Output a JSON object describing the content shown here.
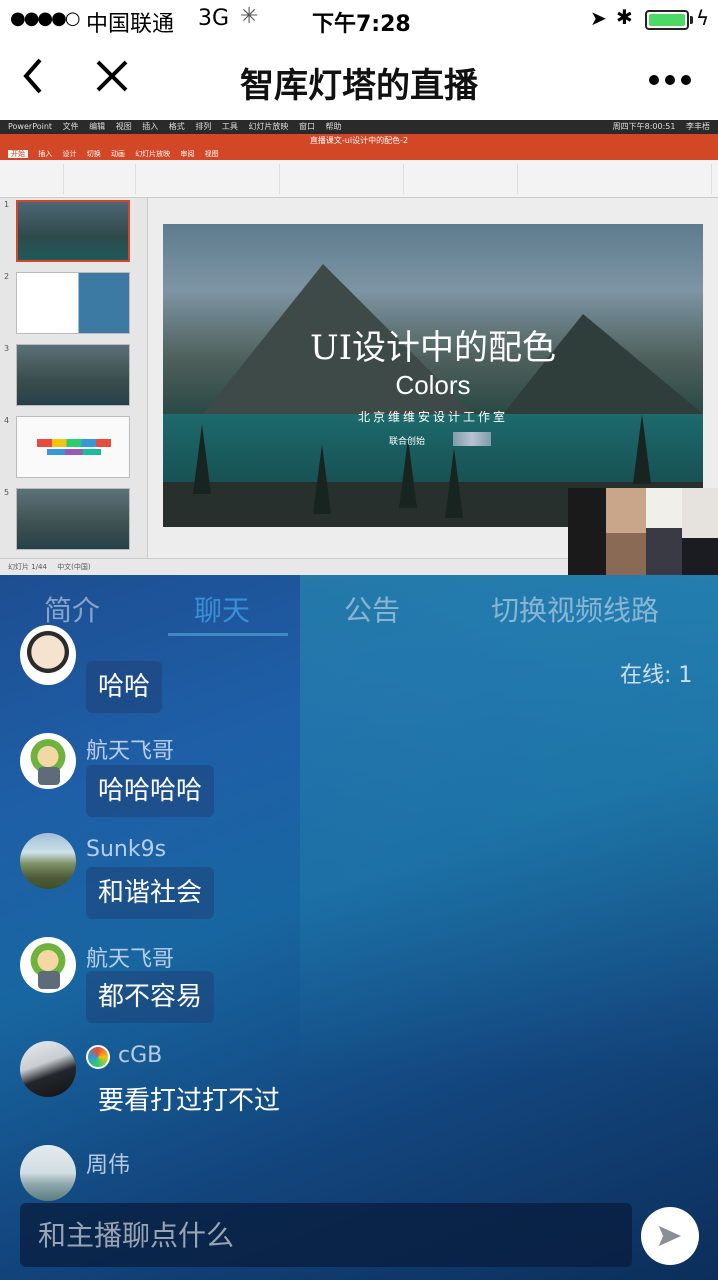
{
  "status_bar": {
    "signal": "●●●●○",
    "carrier": "中国联通",
    "network": "3G",
    "time": "下午7:28"
  },
  "nav": {
    "back_icon": "chevron-left-icon",
    "close_icon": "close-icon",
    "title": "智库灯塔的直播",
    "more_icon": "more-icon"
  },
  "video": {
    "app_menu": [
      "PowerPoint",
      "文件",
      "编辑",
      "视图",
      "插入",
      "格式",
      "排列",
      "工具",
      "幻灯片放映",
      "窗口",
      "帮助"
    ],
    "clock_text": "周四下午8:00:51",
    "user": "李丰梧",
    "doc_title": "直播课文-ui设计中的配色-2",
    "ribbon_tabs": [
      "开始",
      "插入",
      "设计",
      "切换",
      "动画",
      "幻灯片放映",
      "审阅",
      "视图"
    ],
    "thumb_numbers": [
      "1",
      "2",
      "3",
      "4",
      "5"
    ],
    "slide": {
      "title": "UI设计中的配色",
      "subtitle": "Colors",
      "org": "北京维维安设计工作室",
      "author": "联合创始"
    },
    "statusbar_slide": "幻灯片 1/44",
    "statusbar_lang": "中文(中国)"
  },
  "chat": {
    "tabs": [
      {
        "label": "简介"
      },
      {
        "label": "聊天"
      },
      {
        "label": "公告"
      },
      {
        "label": "切换视频线路"
      }
    ],
    "online": "在线: 1",
    "messages": [
      {
        "user": "",
        "text": "哈哈"
      },
      {
        "user": "航天飞哥",
        "text": "哈哈哈哈"
      },
      {
        "user": "Sunk9s",
        "text": "和谐社会"
      },
      {
        "user": "航天飞哥",
        "text": "都不容易"
      },
      {
        "user": "cGB",
        "text": "要看打过打不过"
      },
      {
        "user": "周伟",
        "text": ""
      }
    ],
    "input_placeholder": "和主播聊点什么",
    "send_icon": "send-icon"
  }
}
